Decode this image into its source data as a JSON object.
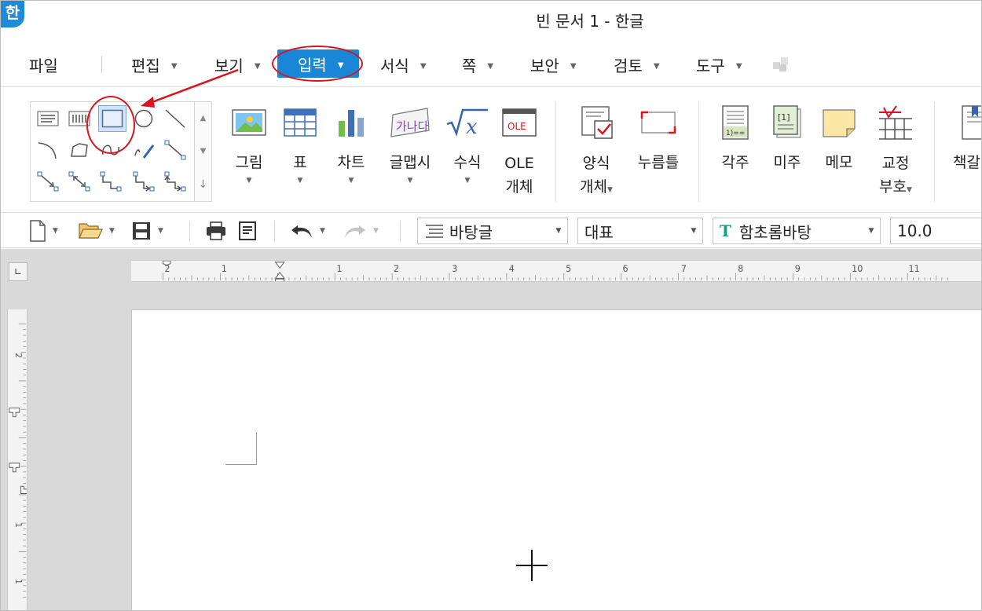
{
  "window": {
    "app_logo": "한",
    "title": "빈 문서 1 - 한글"
  },
  "menu": {
    "file": "파일",
    "items": [
      "편집",
      "보기",
      "입력",
      "서식",
      "쪽",
      "보안",
      "검토",
      "도구"
    ],
    "active": "입력"
  },
  "ribbon": {
    "picture": "그림",
    "table": "표",
    "chart": "차트",
    "glyph": "글맵시",
    "formula": "수식",
    "ole_line1": "OLE",
    "ole_line2": "개체",
    "glyph_icon_text": "가나다",
    "ole_icon_text": "OLE",
    "form_line1": "양식",
    "form_line2": "개체",
    "press_frame": "누름틀",
    "footnote": "각주",
    "endnote": "미주",
    "memo": "메모",
    "proof_line1": "교정",
    "proof_line2": "부호",
    "bookmark_partial": "책갈"
  },
  "toolbar": {
    "style_value": "바탕글",
    "lang_value": "대표",
    "font_value": "함초롬바탕",
    "size_value": "10.0",
    "font_icon": "T"
  },
  "ruler": {
    "h_labels": [
      "2",
      "1",
      "1",
      "2",
      "3",
      "4",
      "5",
      "6",
      "7",
      "8",
      "9",
      "10",
      "11"
    ],
    "v_labels": [
      "2",
      "1",
      "1",
      "2"
    ]
  },
  "colors": {
    "accent": "#1a86d6",
    "annotation": "#d9141c"
  }
}
